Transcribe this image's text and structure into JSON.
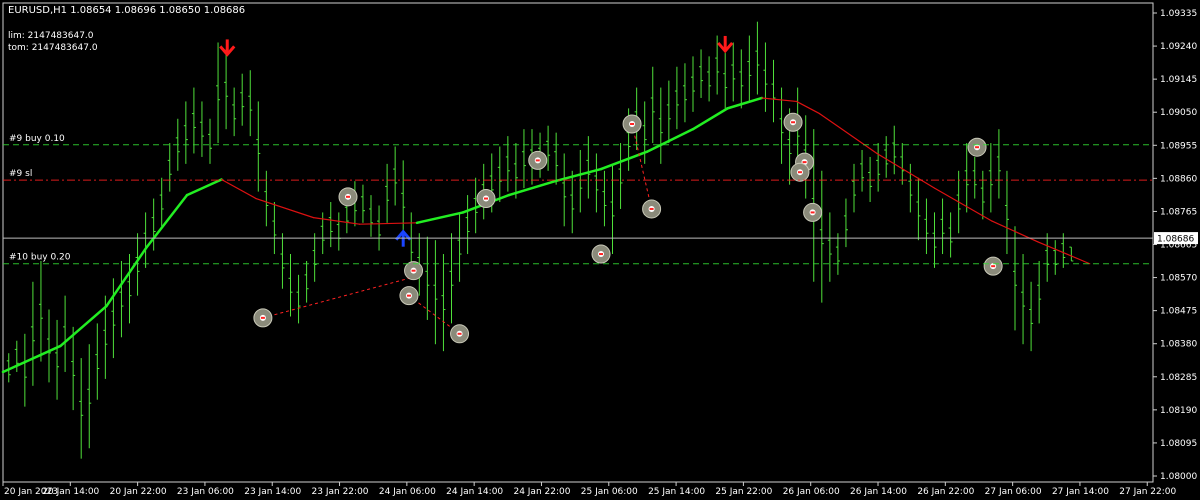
{
  "header": {
    "symbol_info": "EURUSD,H1  1.08654 1.08696 1.08650 1.08686",
    "lim": "lim: 2147483647.0",
    "tom": "tom: 2147483647.0"
  },
  "colors": {
    "background": "#000000",
    "candle": "#4fe03a",
    "grid": "#1e4a1e",
    "ma_up": "#22ee22",
    "ma_down": "#dd1111",
    "order_line": "#33dd33",
    "stop_line": "#ff2222",
    "arrow_down": "#ff1a1a",
    "arrow_up": "#1a44ff",
    "axis_text": "#ffffff",
    "current_price_bg": "#ffffff"
  },
  "chart_data": {
    "type": "candlestick",
    "symbol": "EURUSD",
    "timeframe": "H1",
    "ylim": [
      1.08,
      1.0938
    ],
    "price_ticks": [
      "1.09335",
      "1.09240",
      "1.09145",
      "1.09050",
      "1.08955",
      "1.08860",
      "1.08765",
      "1.08665",
      "1.08570",
      "1.08475",
      "1.08380",
      "1.08285",
      "1.08190",
      "1.08095",
      "1.08000"
    ],
    "time_labels": [
      "20 Jan 2023",
      "20 Jan 14:00",
      "20 Jan 22:00",
      "23 Jan 06:00",
      "23 Jan 14:00",
      "23 Jan 22:00",
      "24 Jan 06:00",
      "24 Jan 14:00",
      "24 Jan 22:00",
      "25 Jan 06:00",
      "25 Jan 14:00",
      "25 Jan 22:00",
      "26 Jan 06:00",
      "26 Jan 14:00",
      "26 Jan 22:00",
      "27 Jan 06:00",
      "27 Jan 14:00",
      "27 Jan 22:00"
    ],
    "current_price": "1.08686",
    "horizontal_levels": [
      {
        "label": "#9 buy 0.10",
        "price": 1.08955,
        "style": "dashed",
        "color": "order"
      },
      {
        "label": "#9 sl",
        "price": 1.08853,
        "style": "dashdot",
        "color": "stop"
      },
      {
        "label": "#10 buy 0.20",
        "price": 1.08612,
        "style": "dashed",
        "color": "order"
      }
    ],
    "ma_line": [
      [
        0,
        1.083
      ],
      [
        0.05,
        1.08375
      ],
      [
        0.09,
        1.0849
      ],
      [
        0.125,
        1.0866
      ],
      [
        0.16,
        1.0881
      ],
      [
        0.19,
        1.08855
      ],
      [
        0.22,
        1.088
      ],
      [
        0.27,
        1.08745
      ],
      [
        0.31,
        1.08726
      ],
      [
        0.36,
        1.0873
      ],
      [
        0.4,
        1.0876
      ],
      [
        0.44,
        1.0881
      ],
      [
        0.48,
        1.0885
      ],
      [
        0.52,
        1.08885
      ],
      [
        0.56,
        1.08935
      ],
      [
        0.6,
        1.09
      ],
      [
        0.63,
        1.0906
      ],
      [
        0.66,
        1.0909
      ],
      [
        0.69,
        1.0908
      ],
      [
        0.71,
        1.09045
      ],
      [
        0.76,
        1.0893
      ],
      [
        0.81,
        1.0883
      ],
      [
        0.86,
        1.08735
      ],
      [
        0.9,
        1.08675
      ],
      [
        0.945,
        1.08612
      ]
    ],
    "ma_down_from": 0.19,
    "ma_up_from": 0.36,
    "ma_down_from_2": 0.655,
    "candles": [
      [
        0.005,
        1.08354,
        1.0827
      ],
      [
        0.012,
        1.0839,
        1.083
      ],
      [
        0.019,
        1.0841,
        1.082
      ],
      [
        0.026,
        1.0856,
        1.0826
      ],
      [
        0.033,
        1.0862,
        1.0833
      ],
      [
        0.04,
        1.0848,
        1.0827
      ],
      [
        0.047,
        1.0845,
        1.0822
      ],
      [
        0.054,
        1.0852,
        1.083
      ],
      [
        0.061,
        1.0843,
        1.0819
      ],
      [
        0.068,
        1.0834,
        1.0805
      ],
      [
        0.075,
        1.0838,
        1.0808
      ],
      [
        0.082,
        1.0844,
        1.0822
      ],
      [
        0.089,
        1.0852,
        1.0828
      ],
      [
        0.096,
        1.0857,
        1.0834
      ],
      [
        0.103,
        1.0862,
        1.084
      ],
      [
        0.11,
        1.0864,
        1.0844
      ],
      [
        0.117,
        1.087,
        1.0852
      ],
      [
        0.124,
        1.0876,
        1.086
      ],
      [
        0.131,
        1.088,
        1.0865
      ],
      [
        0.138,
        1.0886,
        1.0872
      ],
      [
        0.145,
        1.0896,
        1.0882
      ],
      [
        0.152,
        1.0903,
        1.0888
      ],
      [
        0.159,
        1.0908,
        1.089
      ],
      [
        0.166,
        1.0912,
        1.0893
      ],
      [
        0.173,
        1.0908,
        1.0892
      ],
      [
        0.18,
        1.0903,
        1.089
      ],
      [
        0.187,
        1.0925,
        1.0896
      ],
      [
        0.194,
        1.0923,
        1.09
      ],
      [
        0.201,
        1.0912,
        1.0898
      ],
      [
        0.208,
        1.0916,
        1.0901
      ],
      [
        0.215,
        1.0917,
        1.0898
      ],
      [
        0.222,
        1.0908,
        1.0882
      ],
      [
        0.229,
        1.0888,
        1.0872
      ],
      [
        0.236,
        1.0879,
        1.0864
      ],
      [
        0.243,
        1.087,
        1.0854
      ],
      [
        0.25,
        1.0864,
        1.0846
      ],
      [
        0.257,
        1.0858,
        1.0844
      ],
      [
        0.264,
        1.0862,
        1.085
      ],
      [
        0.271,
        1.087,
        1.0856
      ],
      [
        0.278,
        1.0876,
        1.0864
      ],
      [
        0.285,
        1.0879,
        1.0866
      ],
      [
        0.292,
        1.0876,
        1.0865
      ],
      [
        0.299,
        1.0881,
        1.087
      ],
      [
        0.306,
        1.0885,
        1.0872
      ],
      [
        0.313,
        1.0884,
        1.0873
      ],
      [
        0.32,
        1.0881,
        1.0869
      ],
      [
        0.327,
        1.0878,
        1.0865
      ],
      [
        0.334,
        1.089,
        1.0873
      ],
      [
        0.341,
        1.0895,
        1.0878
      ],
      [
        0.348,
        1.0891,
        1.0868
      ],
      [
        0.355,
        1.0876,
        1.0857
      ],
      [
        0.362,
        1.087,
        1.0852
      ],
      [
        0.369,
        1.0869,
        1.0845
      ],
      [
        0.376,
        1.0868,
        1.0838
      ],
      [
        0.383,
        1.0864,
        1.0836
      ],
      [
        0.39,
        1.087,
        1.0844
      ],
      [
        0.397,
        1.0876,
        1.0856
      ],
      [
        0.404,
        1.0881,
        1.0864
      ],
      [
        0.411,
        1.0886,
        1.087
      ],
      [
        0.418,
        1.089,
        1.0874
      ],
      [
        0.425,
        1.0893,
        1.0876
      ],
      [
        0.432,
        1.0895,
        1.0879
      ],
      [
        0.439,
        1.0898,
        1.0882
      ],
      [
        0.446,
        1.0896,
        1.088
      ],
      [
        0.453,
        1.09,
        1.0883
      ],
      [
        0.46,
        1.09,
        1.0884
      ],
      [
        0.467,
        1.0899,
        1.0886
      ],
      [
        0.474,
        1.0901,
        1.0888
      ],
      [
        0.481,
        1.0899,
        1.0884
      ],
      [
        0.488,
        1.0893,
        1.0872
      ],
      [
        0.495,
        1.0888,
        1.087
      ],
      [
        0.502,
        1.0894,
        1.0876
      ],
      [
        0.509,
        1.0898,
        1.088
      ],
      [
        0.516,
        1.0893,
        1.0876
      ],
      [
        0.523,
        1.0888,
        1.0872
      ],
      [
        0.53,
        1.089,
        1.0864
      ],
      [
        0.537,
        1.0896,
        1.0877
      ],
      [
        0.544,
        1.0906,
        1.0888
      ],
      [
        0.551,
        1.0912,
        1.0894
      ],
      [
        0.558,
        1.0908,
        1.089
      ],
      [
        0.565,
        1.0918,
        1.0896
      ],
      [
        0.572,
        1.0912,
        1.089
      ],
      [
        0.579,
        1.0914,
        1.0896
      ],
      [
        0.586,
        1.0918,
        1.09
      ],
      [
        0.593,
        1.0919,
        1.0902
      ],
      [
        0.6,
        1.0921,
        1.0905
      ],
      [
        0.607,
        1.0923,
        1.0909
      ],
      [
        0.614,
        1.0921,
        1.0908
      ],
      [
        0.621,
        1.0927,
        1.091
      ],
      [
        0.628,
        1.0922,
        1.0906
      ],
      [
        0.635,
        1.0925,
        1.0908
      ],
      [
        0.642,
        1.0923,
        1.0906
      ],
      [
        0.649,
        1.0927,
        1.0908
      ],
      [
        0.656,
        1.0931,
        1.091
      ],
      [
        0.663,
        1.0925,
        1.0905
      ],
      [
        0.67,
        1.092,
        1.0902
      ],
      [
        0.677,
        1.0912,
        1.089
      ],
      [
        0.684,
        1.0906,
        1.0884
      ],
      [
        0.691,
        1.0912,
        1.0888
      ],
      [
        0.698,
        1.0904,
        1.088
      ],
      [
        0.705,
        1.09,
        1.0856
      ],
      [
        0.712,
        1.0888,
        1.085
      ],
      [
        0.719,
        1.0876,
        1.0856
      ],
      [
        0.726,
        1.087,
        1.0858
      ],
      [
        0.733,
        1.088,
        1.0866
      ],
      [
        0.74,
        1.089,
        1.0876
      ],
      [
        0.747,
        1.0894,
        1.0882
      ],
      [
        0.754,
        1.0892,
        1.0879
      ],
      [
        0.761,
        1.0896,
        1.0882
      ],
      [
        0.768,
        1.0898,
        1.0886
      ],
      [
        0.775,
        1.0901,
        1.0887
      ],
      [
        0.782,
        1.0896,
        1.0884
      ],
      [
        0.789,
        1.089,
        1.0876
      ],
      [
        0.796,
        1.0886,
        1.0868
      ],
      [
        0.803,
        1.088,
        1.0864
      ],
      [
        0.81,
        1.0876,
        1.086
      ],
      [
        0.817,
        1.088,
        1.0864
      ],
      [
        0.824,
        1.0876,
        1.0863
      ],
      [
        0.831,
        1.0888,
        1.087
      ],
      [
        0.838,
        1.0896,
        1.0876
      ],
      [
        0.845,
        1.0892,
        1.088
      ],
      [
        0.852,
        1.0888,
        1.0874
      ],
      [
        0.859,
        1.0896,
        1.0876
      ],
      [
        0.866,
        1.09,
        1.088
      ],
      [
        0.873,
        1.0888,
        1.0864
      ],
      [
        0.88,
        1.0872,
        1.0842
      ],
      [
        0.887,
        1.0864,
        1.0838
      ],
      [
        0.894,
        1.0856,
        1.0836
      ],
      [
        0.901,
        1.0862,
        1.0844
      ],
      [
        0.908,
        1.087,
        1.0856
      ],
      [
        0.915,
        1.0868,
        1.0858
      ],
      [
        0.922,
        1.087,
        1.086
      ],
      [
        0.929,
        1.0866,
        1.0862
      ]
    ],
    "markers": [
      {
        "name": "sell-arrow-1",
        "kind": "arrow_down",
        "x": 0.195,
        "price": 1.0923
      },
      {
        "name": "sell-arrow-2",
        "kind": "arrow_down",
        "x": 0.628,
        "price": 1.0924
      },
      {
        "name": "buy-arrow-1",
        "kind": "arrow_up",
        "x": 0.348,
        "price": 1.0869
      },
      {
        "name": "trade-circle-1",
        "kind": "circle",
        "x": 0.226,
        "price": 1.08456
      },
      {
        "name": "trade-circle-2",
        "kind": "circle",
        "x": 0.3,
        "price": 1.08805
      },
      {
        "name": "trade-circle-3",
        "kind": "circle",
        "x": 0.353,
        "price": 1.0852
      },
      {
        "name": "trade-circle-4",
        "kind": "circle",
        "x": 0.357,
        "price": 1.08592
      },
      {
        "name": "trade-circle-5",
        "kind": "circle",
        "x": 0.397,
        "price": 1.0841
      },
      {
        "name": "trade-circle-6",
        "kind": "circle",
        "x": 0.42,
        "price": 1.088
      },
      {
        "name": "trade-circle-7",
        "kind": "circle",
        "x": 0.465,
        "price": 1.0891
      },
      {
        "name": "trade-circle-8",
        "kind": "circle",
        "x": 0.52,
        "price": 1.0864
      },
      {
        "name": "trade-circle-9",
        "kind": "circle",
        "x": 0.547,
        "price": 1.09015
      },
      {
        "name": "trade-circle-10",
        "kind": "circle",
        "x": 0.564,
        "price": 1.0877
      },
      {
        "name": "trade-circle-11",
        "kind": "circle",
        "x": 0.687,
        "price": 1.0902
      },
      {
        "name": "trade-circle-12",
        "kind": "circle",
        "x": 0.697,
        "price": 1.08905
      },
      {
        "name": "trade-circle-13",
        "kind": "circle",
        "x": 0.693,
        "price": 1.08876
      },
      {
        "name": "trade-circle-14",
        "kind": "circle",
        "x": 0.704,
        "price": 1.0876
      },
      {
        "name": "trade-circle-15",
        "kind": "circle",
        "x": 0.847,
        "price": 1.08948
      },
      {
        "name": "trade-circle-16",
        "kind": "circle",
        "x": 0.861,
        "price": 1.08605
      }
    ],
    "trade_links": [
      [
        0.226,
        1.08456,
        0.353,
        1.0857
      ],
      [
        0.353,
        1.0852,
        0.397,
        1.0841
      ],
      [
        0.353,
        1.0857,
        0.357,
        1.08592
      ],
      [
        0.547,
        1.09015,
        0.564,
        1.0877
      ]
    ]
  }
}
